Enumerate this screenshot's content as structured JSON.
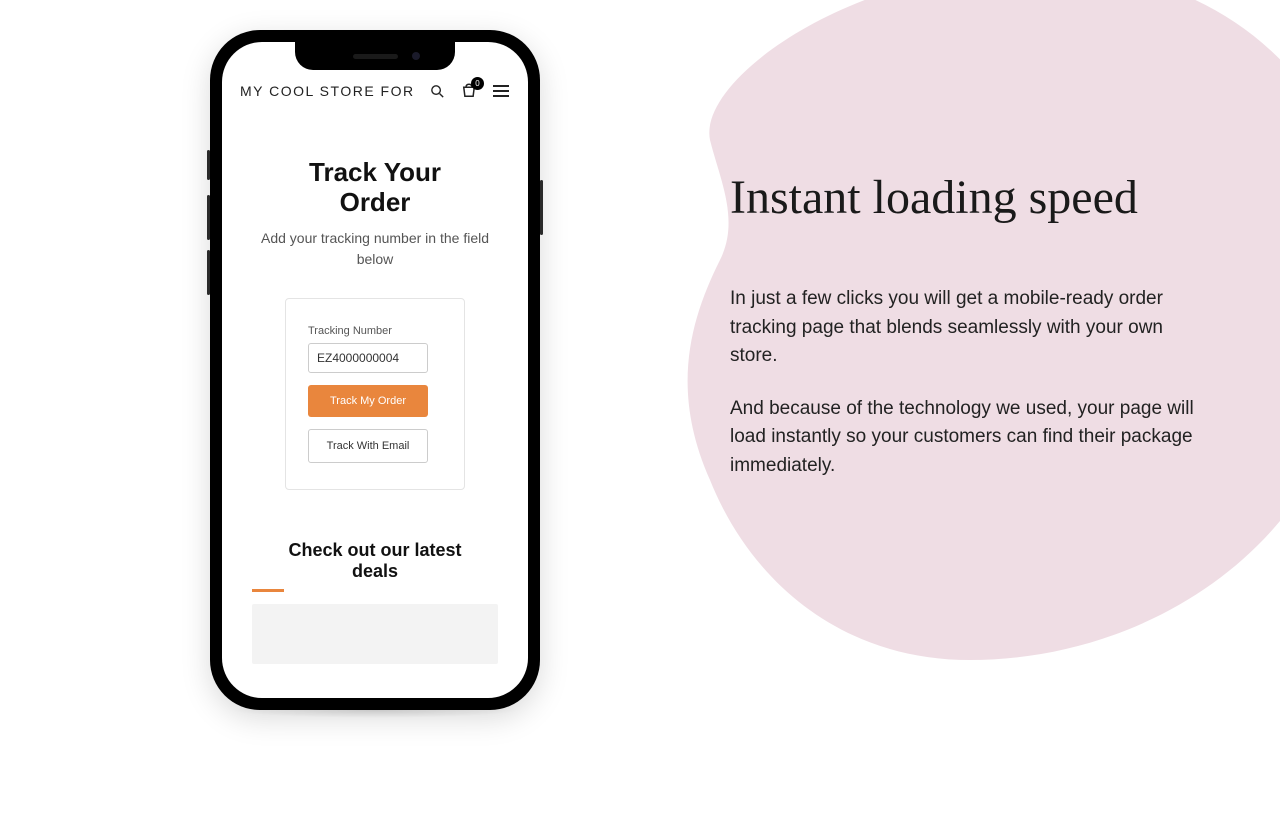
{
  "marketing": {
    "headline": "Instant loading speed",
    "paragraph1": "In just a few clicks you will get a mobile-ready order tracking page that blends seamlessly with your own store.",
    "paragraph2": "And because of the technology we used, your  page will load instantly so your customers can find their package immediately."
  },
  "phone": {
    "store_name": "MY COOL STORE FOR",
    "cart_count": "0",
    "track": {
      "title": "Track Your Order",
      "subtitle": "Add your tracking number in the field below",
      "field_label": "Tracking Number",
      "field_value": "EZ4000000004",
      "primary_button": "Track My Order",
      "secondary_button": "Track With Email"
    },
    "deals_title": "Check out our latest deals"
  },
  "colors": {
    "accent": "#e9863d",
    "blob": "#efdde4"
  }
}
